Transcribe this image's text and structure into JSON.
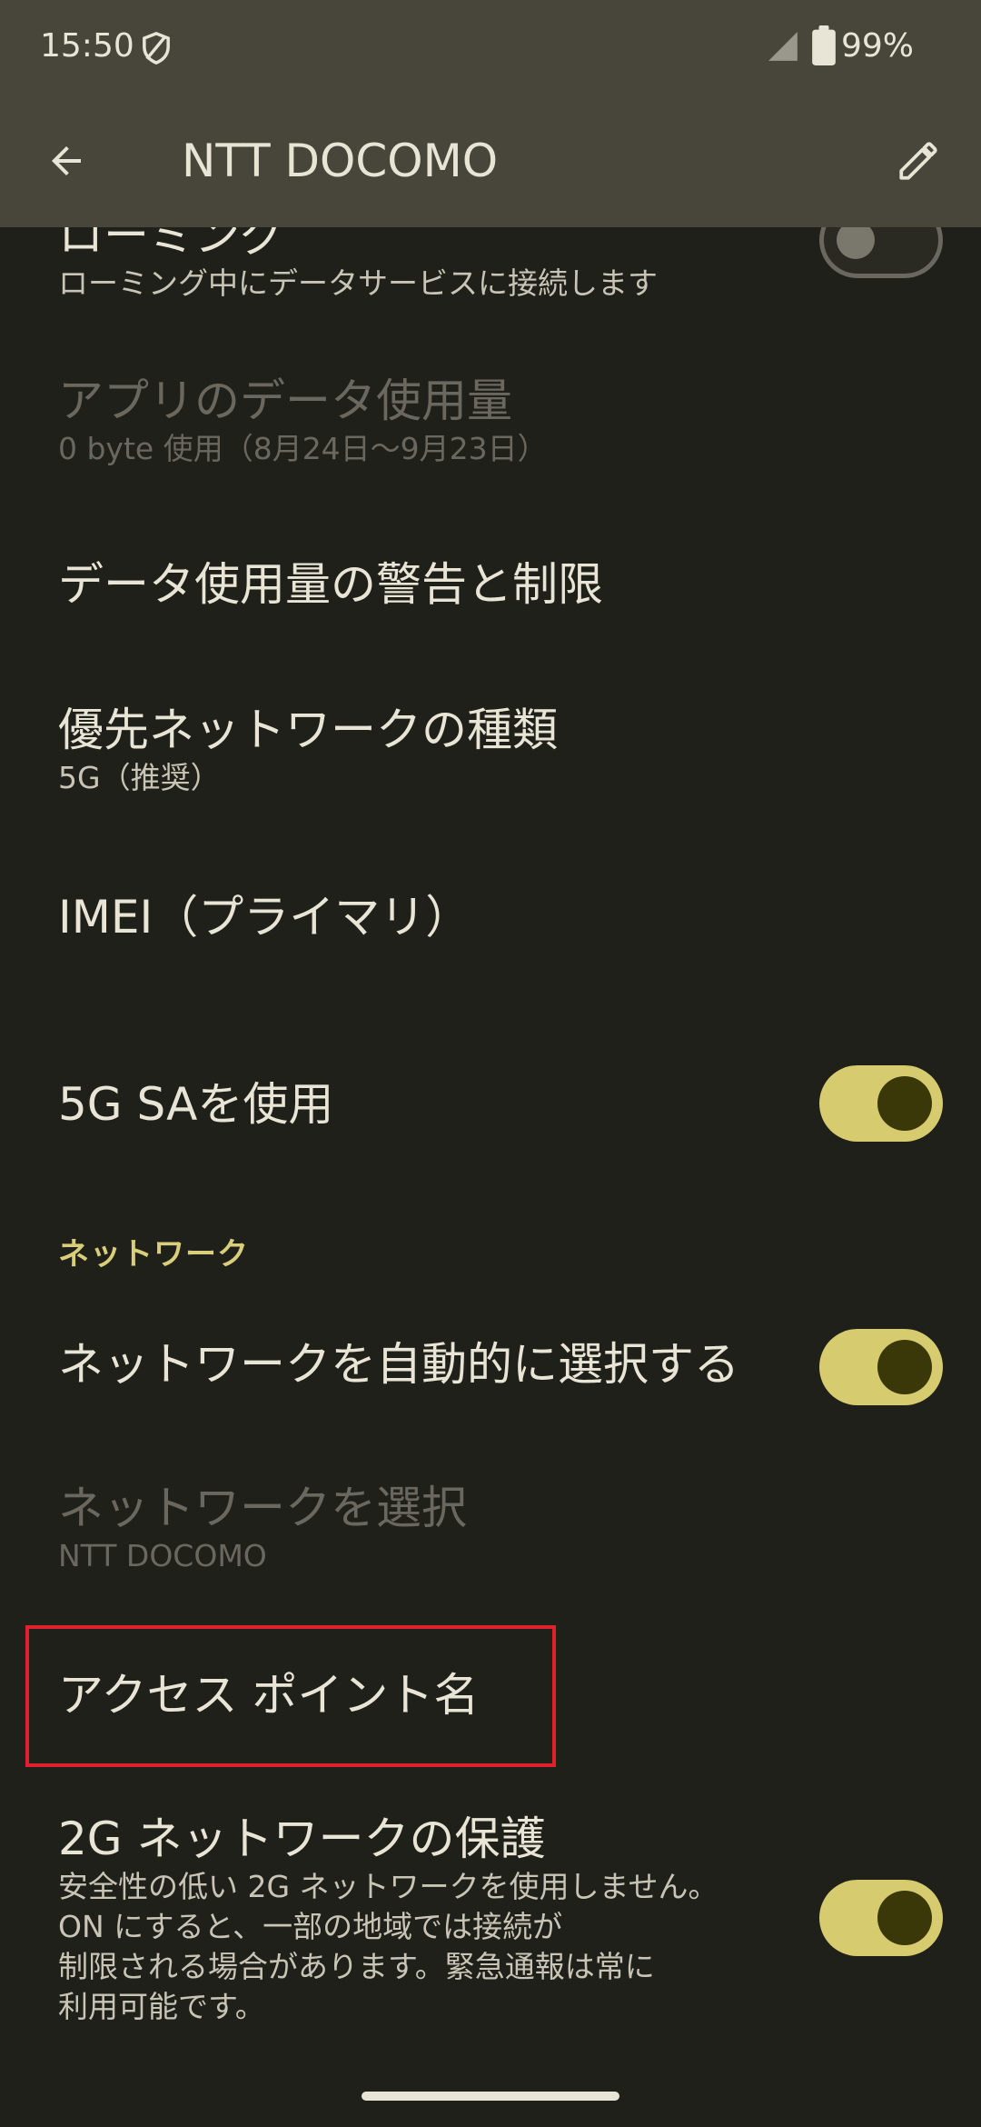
{
  "status_bar": {
    "time": "15:50",
    "battery": "99%"
  },
  "app_bar": {
    "title": "NTT DOCOMO",
    "back_icon": "arrow-left-icon",
    "edit_icon": "pencil-icon"
  },
  "items": {
    "roaming": {
      "title": "ローミング",
      "summary": "ローミング中にデータサービスに接続します",
      "toggle_on": false
    },
    "app_data_usage": {
      "title": "アプリのデータ使用量",
      "summary": "0 byte 使用（8月24日～9月23日）"
    },
    "data_warning": {
      "title": "データ使用量の警告と制限"
    },
    "preferred_network": {
      "title": "優先ネットワークの種類",
      "summary": "5G（推奨）"
    },
    "imei": {
      "title": "IMEI（プライマリ）"
    },
    "use_5g_sa": {
      "title": "5G SAを使用",
      "toggle_on": true
    }
  },
  "network_section": {
    "header": "ネットワーク",
    "auto_select": {
      "title": "ネットワークを自動的に選択する",
      "toggle_on": true
    },
    "select_network": {
      "title": "ネットワークを選択",
      "summary": "NTT DOCOMO"
    },
    "apn": {
      "title": "アクセス ポイント名"
    },
    "protection_2g": {
      "title": "2G ネットワークの保護",
      "summary_lines": [
        "安全性の低い 2G ネットワークを使用しません。",
        "ON にすると、一部の地域では接続が",
        "制限される場合があります。緊急通報は常に",
        "利用可能です。"
      ],
      "toggle_on": true
    }
  },
  "colors": {
    "background": "#20201a",
    "app_bar": "#48463a",
    "accent": "#d6cb6e",
    "highlight": "#e0202a"
  }
}
